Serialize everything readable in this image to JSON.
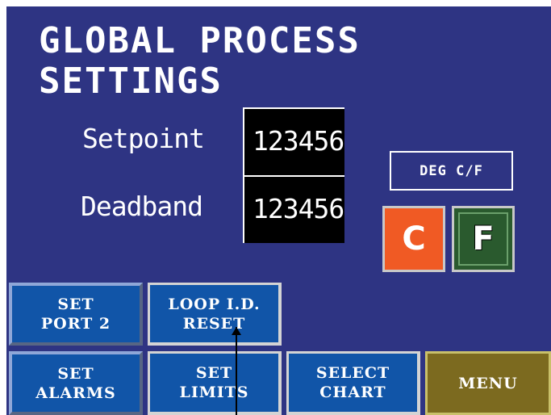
{
  "screen": {
    "title": "GLOBAL PROCESS\nSETTINGS",
    "fields": [
      {
        "label": "Setpoint",
        "value": "123456"
      },
      {
        "label": "Deadband",
        "value": "123456"
      }
    ],
    "unit": {
      "label": "DEG C/F",
      "c_label": "C",
      "f_label": "F"
    },
    "buttons": {
      "set_port": "SET\nPORT 2",
      "loop_reset": "LOOP I.D.\nRESET",
      "set_alarms": "SET\nALARMS",
      "set_limits": "SET\nLIMITS",
      "select_chart": "SELECT\nCHART",
      "menu": "MENU"
    }
  },
  "colors": {
    "background": "#2e3483",
    "button_blue": "#1155a8",
    "c_button": "#f05a24",
    "f_button": "#2a5a2e",
    "menu_button": "#7c6a1f"
  }
}
